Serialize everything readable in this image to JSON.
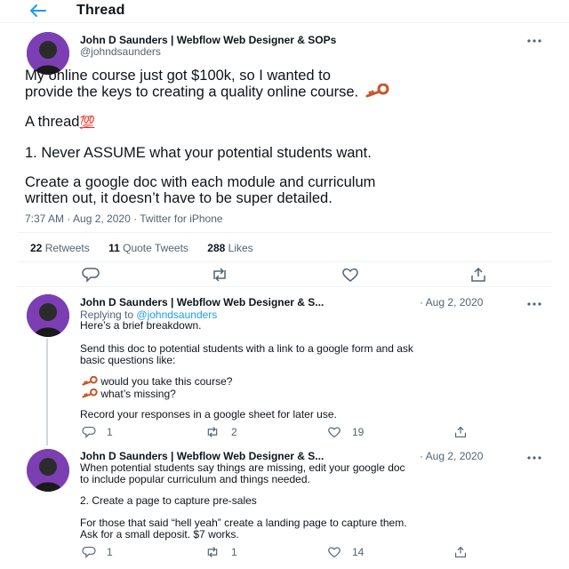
{
  "header": {
    "title": "Thread",
    "back_icon": "arrow-left-icon"
  },
  "main_tweet": {
    "display_name": "John D Saunders | Webflow Web Designer & SOPs",
    "handle": "@johndsaunders",
    "text_line1": "My online course just got $100k, so I wanted to",
    "text_line2": "provide the keys to creating a quality online course.",
    "text_line3": "A thread",
    "hundred_emoji": "💯",
    "text_line4": "1. Never ASSUME what your potential students want.",
    "text_line5": "Create a google doc with each module and curriculum",
    "text_line6": "written out, it doesn’t have to be super detailed.",
    "time": "7:37 AM · Aug 2, 2020 · ",
    "source": "Twitter for iPhone",
    "retweets_count": "22",
    "retweets_label": "Retweets",
    "quotes_count": "11",
    "quotes_label": "Quote Tweets",
    "likes_count": "288",
    "likes_label": "Likes"
  },
  "reply1": {
    "display_name": "John D Saunders | Webflow Web Designer & S...",
    "date": "· Aug 2, 2020",
    "replying_prefix": "Replying to",
    "replying_handle": "@johndsaunders",
    "line1": "Here’s a brief breakdown.",
    "line2": "Send this doc to potential students with a link to a google form and ask",
    "line3": "basic questions like:",
    "bullet1": "would you take this course?",
    "bullet2": "what’s missing?",
    "line4": "Record your responses in a google sheet for later use.",
    "replies": "1",
    "retweets": "2",
    "likes": "19"
  },
  "reply2": {
    "display_name": "John D Saunders | Webflow Web Designer & S...",
    "date": "· Aug 2, 2020",
    "line1": "When potential students say things are missing, edit your google doc",
    "line2": "to include popular curriculum and things needed.",
    "line3": "2. Create a page to capture pre-sales",
    "line4": "For those that said “hell yeah” create a landing page to capture them.",
    "line5": "Ask for a small deposit. $7 works.",
    "replies": "1",
    "retweets": "1",
    "likes": "14"
  },
  "colors": {
    "accent": "#1d9bf0",
    "muted": "#536471",
    "avatar_bg": "#7b3fb3",
    "key": "#c8552a"
  }
}
